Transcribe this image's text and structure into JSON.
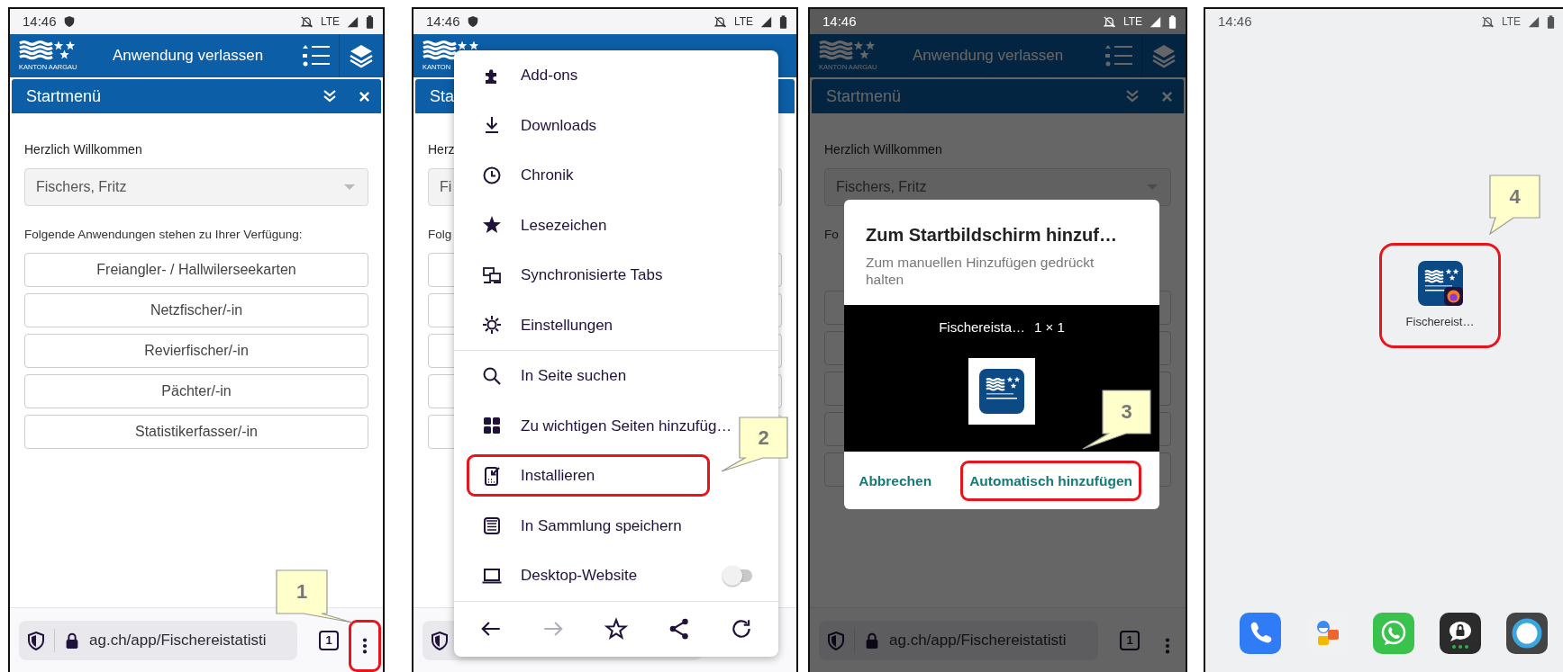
{
  "panels": [
    {
      "kind": "app",
      "status_bar": {
        "time": "14:46",
        "shield": true,
        "network": "LTE",
        "dimmed": false
      },
      "header": {
        "logo_text": "KANTON AARGAU",
        "title": "Anwendung verlassen"
      },
      "panel_title": "Startmenü",
      "welcome_label": "Herzlich Willkommen",
      "user_select": "Fischers, Fritz",
      "apps_label": "Folgende Anwendungen stehen zu Ihrer Verfügung:",
      "app_buttons": [
        "Freiangler- / Hallwilerseekarten",
        "Netzfischer/-in",
        "Revierfischer/-in",
        "Pächter/-in",
        "Statistikerfasser/-in"
      ],
      "url_bar": {
        "url": "ag.ch/app/Fischereistatisti",
        "tab_count": "1",
        "menu_button": {
          "highlighted": true
        }
      },
      "callout": "1"
    },
    {
      "kind": "menu",
      "status_bar": {
        "time": "14:46",
        "shield": true,
        "network": "LTE",
        "dimmed": false
      },
      "header": {
        "logo_text": "KANTON"
      },
      "panel_title": "Sta",
      "welcome_label": "Herz",
      "user_select": "Fi",
      "apps_label": "Folg",
      "blank_buttons": [
        {
          "kind": "outline"
        },
        {
          "kind": "outline"
        },
        {
          "kind": "outline"
        },
        {
          "kind": "outline"
        },
        {
          "kind": "outline"
        }
      ],
      "menu": {
        "items": [
          {
            "kind": "addons",
            "label": "Add-ons",
            "highlighted": false
          },
          {
            "kind": "download",
            "label": "Downloads",
            "highlighted": false
          },
          {
            "kind": "history",
            "label": "Chronik",
            "highlighted": false
          },
          {
            "kind": "bookmark",
            "label": "Lesezeichen",
            "highlighted": false
          },
          {
            "kind": "sync",
            "label": "Synchronisierte Tabs",
            "highlighted": false
          },
          {
            "kind": "settings",
            "label": "Einstellungen",
            "highlighted": false
          },
          {
            "kind": "divider"
          },
          {
            "kind": "find",
            "label": "In Seite suchen",
            "highlighted": false
          },
          {
            "kind": "shortcuts",
            "label": "Zu wichtigen Seiten hinzufüg…",
            "highlighted": false
          },
          {
            "kind": "install",
            "label": "Installieren",
            "highlighted": true
          },
          {
            "kind": "collection",
            "label": "In Sammlung speichern",
            "highlighted": false
          },
          {
            "kind": "desktop",
            "label": "Desktop-Website",
            "highlighted": false,
            "toggle": {
              "on": false
            }
          }
        ],
        "toolbar": [
          {
            "kind": "back",
            "disabled": false
          },
          {
            "kind": "forward",
            "disabled": true
          },
          {
            "kind": "bookmark",
            "disabled": false
          },
          {
            "kind": "share",
            "disabled": false
          },
          {
            "kind": "reload",
            "disabled": false
          }
        ]
      },
      "callout": "2"
    },
    {
      "kind": "dialog",
      "status_bar": {
        "time": "14:46",
        "shield": false,
        "network": "LTE",
        "dimmed": true
      },
      "header": {
        "logo_text": "KANTON AARGAU",
        "title": "Anwendung verlassen"
      },
      "panel_title": "Startmenü",
      "welcome_label": "Herzlich Willkommen",
      "user_select": "Fischers, Fritz",
      "apps_label": "Fo",
      "blank_buttons": [
        {
          "kind": "outline"
        },
        {
          "kind": "outline"
        },
        {
          "kind": "outline"
        },
        {
          "kind": "outline"
        },
        {
          "kind": "outline"
        }
      ],
      "url_bar": {
        "url": "ag.ch/app/Fischereistatisti",
        "tab_count": "1",
        "menu_button": {
          "highlighted": false
        }
      },
      "dialog": {
        "title": "Zum Startbildschirm hinzuf…",
        "message": "Zum manuellen Hinzufügen gedrückt halten",
        "preview_label": "Fischereista…",
        "preview_size": "1 × 1",
        "buttons": [
          {
            "label": "Abbrechen",
            "highlighted": false
          },
          {
            "label": "Automatisch hinzufügen",
            "highlighted": true
          }
        ]
      },
      "callout": "3"
    },
    {
      "kind": "home",
      "status_bar": {
        "time": "14:46",
        "shield": false,
        "network": "LTE",
        "dimmed": false
      },
      "shortcut": {
        "label": "Fischereist…",
        "highlighted": true
      },
      "dock": [
        {
          "kind": "phone"
        },
        {
          "kind": "contacts"
        },
        {
          "kind": "whatsapp"
        },
        {
          "kind": "secure_chat"
        },
        {
          "kind": "circle"
        }
      ],
      "callout": "4"
    }
  ]
}
